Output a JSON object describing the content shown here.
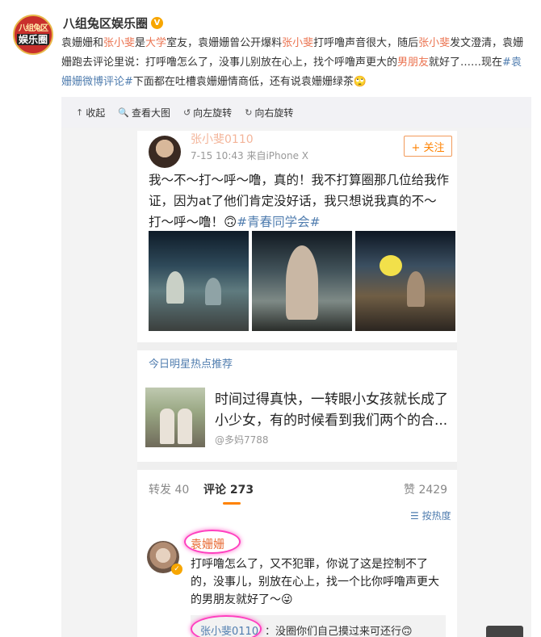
{
  "post": {
    "author": "八组兔区娱乐圈",
    "verified_badge": "V",
    "avatar_text_top": "八组兔区",
    "avatar_text_bottom": "娱乐圈",
    "text_segments": [
      {
        "t": "袁姗姗和",
        "style": "plain"
      },
      {
        "t": "张小斐",
        "style": "hl"
      },
      {
        "t": "是",
        "style": "plain"
      },
      {
        "t": "大学",
        "style": "hl"
      },
      {
        "t": "室友，袁姗姗曾公开爆料",
        "style": "plain"
      },
      {
        "t": "张小斐",
        "style": "hl"
      },
      {
        "t": "打呼噜声音很大，随后",
        "style": "plain"
      },
      {
        "t": "张小斐",
        "style": "hl"
      },
      {
        "t": "发文澄清，袁姗姗跑去评论里说：打呼噜怎么了，没事儿别放在心上，找个呼噜声更大的",
        "style": "plain"
      },
      {
        "t": "男朋友",
        "style": "hl"
      },
      {
        "t": "就好了……现在",
        "style": "plain"
      },
      {
        "t": "#袁姗姗微博评论#",
        "style": "lk"
      },
      {
        "t": "下面都在吐槽袁姗姗情商低，还有说袁姗姗绿茶",
        "style": "plain"
      },
      {
        "t": "🙄",
        "style": "plain"
      }
    ]
  },
  "toolbar": {
    "items": [
      {
        "icon": "↑",
        "label": "收起",
        "name": "collapse-button",
        "icon_name": "collapse-icon"
      },
      {
        "icon": "🔍",
        "label": "查看大图",
        "name": "view-large-button",
        "icon_name": "search-icon"
      },
      {
        "icon": "↺",
        "label": "向左旋转",
        "name": "rotate-left-button",
        "icon_name": "rotate-left-icon"
      },
      {
        "icon": "↻",
        "label": "向右旋转",
        "name": "rotate-right-button",
        "icon_name": "rotate-right-icon"
      }
    ]
  },
  "inner_post": {
    "name": "张小斐0110",
    "meta": "7-15 10:43 来自iPhone X",
    "follow": "+ 关注",
    "body": "我～不～打～呼～噜，真的！我不打算圈那几位给我作证，因为at了他们肯定没好话，我只想说我真的不～打～呼～噜！🙃",
    "tag": "#青春同学会#"
  },
  "hot": {
    "title": "今日明星热点推荐",
    "text": "时间过得真快，一转眼小女孩就长成了小少女，有的时候看到我们两个的合...",
    "user": "@多妈7788"
  },
  "tabs": {
    "repost": "转发 40",
    "comment": "评论 273",
    "like": "赞 2429"
  },
  "sort_label": "按热度",
  "comment": {
    "name": "袁姗姗",
    "text": "打呼噜怎么了，又不犯罪，你说了这是控制不了的，没事儿，别放在心上，找一个比你呼噜声更大的男朋友就好了～😜",
    "reply_name": "张小斐0110",
    "reply_text": "：没圈你们自己摸过来可还行🙃"
  },
  "colors": {
    "highlight": "#eb7350",
    "link": "#507daf",
    "orange": "#ff8200",
    "circle": "#ff3fbf"
  }
}
